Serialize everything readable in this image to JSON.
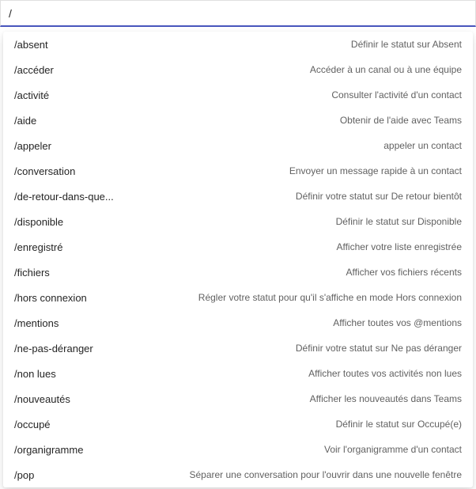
{
  "search": {
    "value": "/"
  },
  "commands": [
    {
      "name": "/absent",
      "desc": "Définir le statut sur Absent"
    },
    {
      "name": "/accéder",
      "desc": "Accéder à un canal ou à une équipe"
    },
    {
      "name": "/activité",
      "desc": "Consulter l'activité d'un contact"
    },
    {
      "name": "/aide",
      "desc": "Obtenir de l'aide avec Teams"
    },
    {
      "name": "/appeler",
      "desc": "appeler un contact"
    },
    {
      "name": "/conversation",
      "desc": "Envoyer un message rapide à un contact"
    },
    {
      "name": "/de-retour-dans-que...",
      "desc": "Définir votre statut sur De retour bientôt"
    },
    {
      "name": "/disponible",
      "desc": "Définir le statut sur Disponible"
    },
    {
      "name": "/enregistré",
      "desc": "Afficher votre liste enregistrée"
    },
    {
      "name": "/fichiers",
      "desc": "Afficher vos fichiers récents"
    },
    {
      "name": "/hors connexion",
      "desc": "Régler votre statut pour qu'il s'affiche en mode Hors connexion"
    },
    {
      "name": "/mentions",
      "desc": "Afficher toutes vos @mentions"
    },
    {
      "name": "/ne-pas-déranger",
      "desc": "Définir votre statut sur Ne pas déranger"
    },
    {
      "name": "/non lues",
      "desc": "Afficher toutes vos activités non lues"
    },
    {
      "name": "/nouveautés",
      "desc": "Afficher les nouveautés dans Teams"
    },
    {
      "name": "/occupé",
      "desc": "Définir le statut sur Occupé(e)"
    },
    {
      "name": "/organigramme",
      "desc": "Voir l'organigramme d'un contact"
    },
    {
      "name": "/pop",
      "desc": "Séparer une conversation pour l'ouvrir dans une nouvelle fenêtre"
    }
  ]
}
